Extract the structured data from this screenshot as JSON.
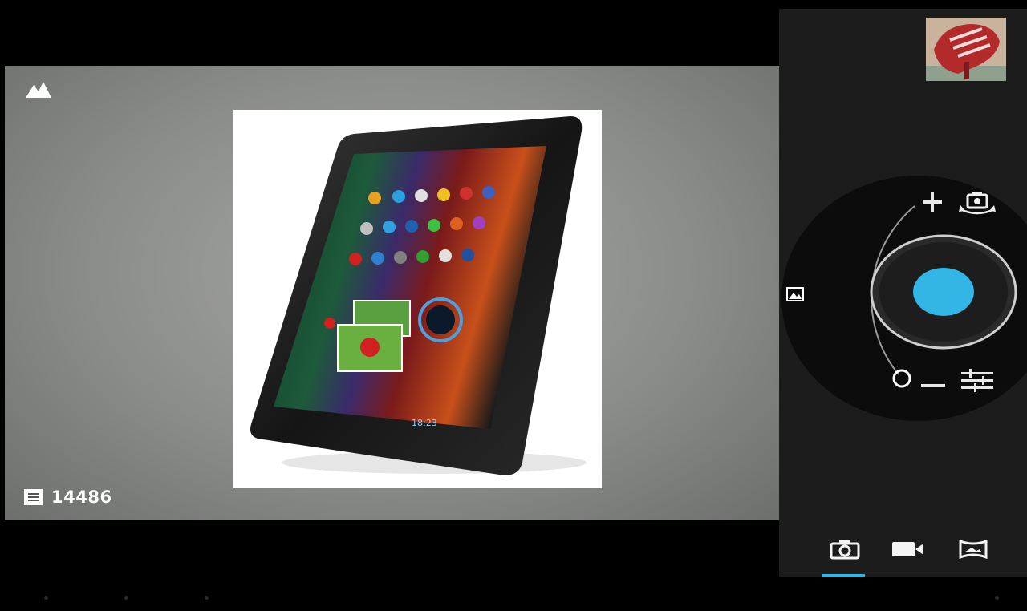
{
  "viewfinder": {
    "scene_mode_icon": "mountain-icon",
    "remaining_shots": {
      "icon": "storage-card-icon",
      "count": "14486"
    }
  },
  "last_photo_thumbnail": {
    "icon": "photo-thumbnail"
  },
  "controls": {
    "zoom_in_icon": "plus-icon",
    "zoom_out_icon": "minus-icon",
    "switch_camera_icon": "switch-camera-icon",
    "settings_icon": "sliders-icon",
    "gallery_icon": "gallery-icon",
    "shutter_color": "#33b5e5"
  },
  "modes": [
    {
      "name": "photo",
      "icon": "camera-icon",
      "selected": true
    },
    {
      "name": "video",
      "icon": "video-camera-icon",
      "selected": false
    },
    {
      "name": "panorama",
      "icon": "panorama-icon",
      "selected": false
    }
  ],
  "accent_color": "#33b5e5"
}
